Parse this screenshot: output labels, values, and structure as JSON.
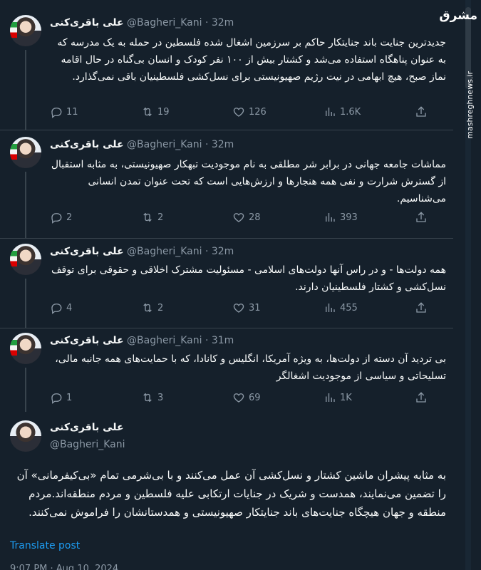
{
  "tweets": [
    {
      "name": "علی باقری‌کنی",
      "handle": "@Bagheri_Kani",
      "time": "32m",
      "text": "جدیدترین جنایت باند جنایتکار حاکم بر سرزمین اشغال شده فلسطین در حمله به یک مدرسه که به عنوان پناهگاه استفاده می‌شد و کشتار بیش از ۱۰۰ نفر کودک و انسان بی‌گناه در حال اقامه نماز صبح، هیچ ابهامی در نیت رژیم صهیونیستی برای نسل‌کشی فلسطینیان باقی نمی‌گذارد.",
      "replies": "11",
      "reposts": "19",
      "likes": "126",
      "views": "1.6K"
    },
    {
      "name": "علی باقری‌کنی",
      "handle": "@Bagheri_Kani",
      "time": "32m",
      "text": "مماشات جامعه جهانی در برابر شر مطلقی به نام موجودیت تبهکار صهیونیستی، به مثابه استقبال از گسترش شرارت و نفی همه هنجارها و ارزش‌هایی است که تحت عنوان تمدن انسانی می‌شناسیم.",
      "replies": "2",
      "reposts": "2",
      "likes": "28",
      "views": "393"
    },
    {
      "name": "علی باقری‌کنی",
      "handle": "@Bagheri_Kani",
      "time": "32m",
      "text": "همه دولت‌ها - و در راس آنها دولت‌های اسلامی - مسئولیت مشترک اخلاقی و حقوقی برای توقف نسل‌کشی و کشتار فلسطینیان دارند.",
      "replies": "4",
      "reposts": "2",
      "likes": "31",
      "views": "455"
    },
    {
      "name": "علی باقری‌کنی",
      "handle": "@Bagheri_Kani",
      "time": "31m",
      "text": "بی تردید آن دسته از دولت‌ها، به ویژه آمریکا، انگلیس و کانادا، که با حمایت‌های همه جانبه مالی، تسلیحاتی و سیاسی از موجودیت اشغالگر",
      "replies": "1",
      "reposts": "3",
      "likes": "69",
      "views": "1K"
    }
  ],
  "main": {
    "name": "علی باقری‌کنی",
    "handle": "@Bagheri_Kani",
    "text": "به مثابه پیشران ماشین کشتار و نسل‌کشی آن عمل می‌کنند و با بی‌شرمی تمام «بی‌کیفرمانی» آن را تضمین می‌نمایند، همدست و شریک در جنایات ارتکابی علیه فلسطین و مردم منطقه‌اند.مردم منطقه و جهان هیچگاه جنایت‌های باند جنایتکار صهیونیستی و همدستانشان را فراموش نمی‌کنند.",
    "translate_label": "Translate post",
    "timestamp_fragment": "9:07 PM · Aug 10, 2024"
  },
  "watermark": {
    "logo": "مشرق",
    "site": "mashreghnews.ir"
  }
}
